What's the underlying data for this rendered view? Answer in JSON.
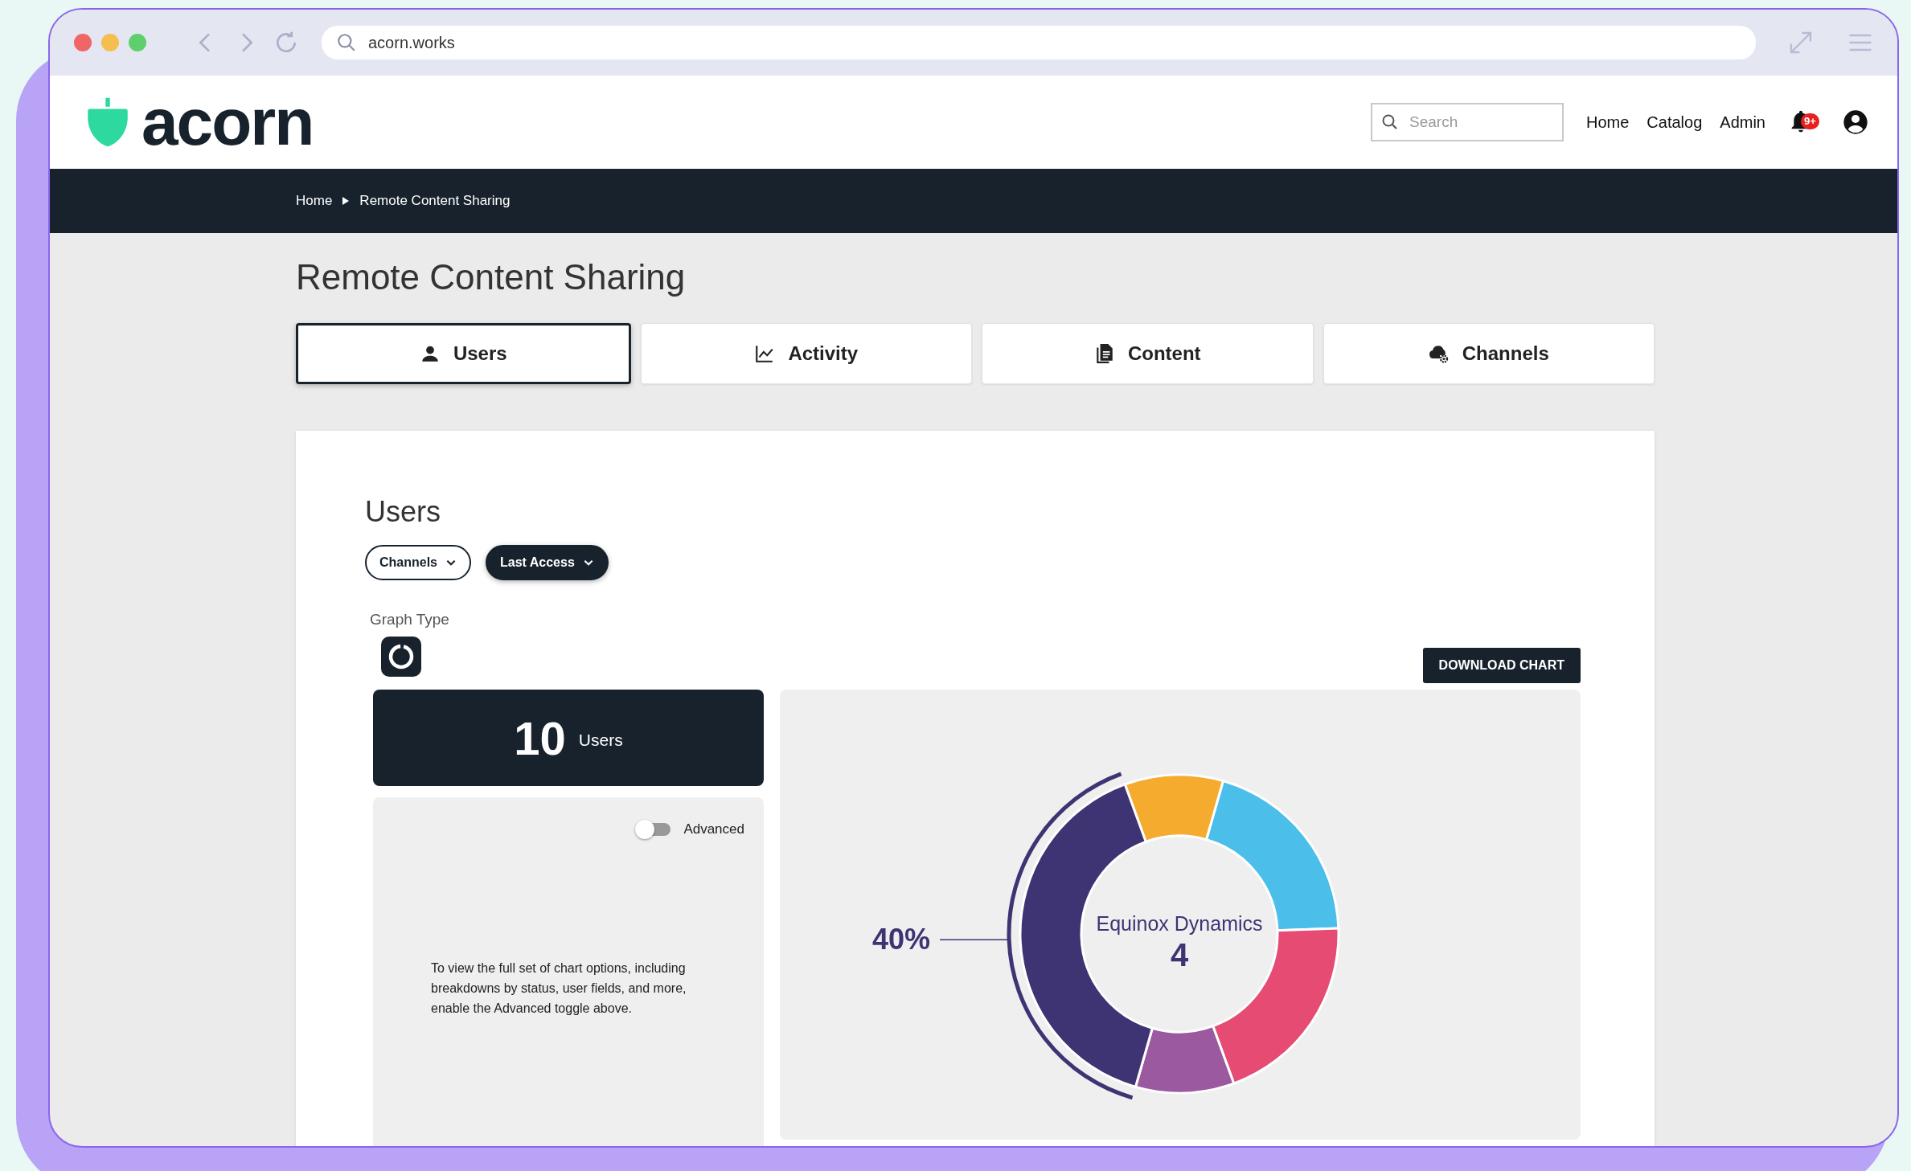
{
  "browser": {
    "url": "acorn.works"
  },
  "header": {
    "logo": "acorn",
    "search": {
      "placeholder": "Search"
    },
    "nav": [
      "Home",
      "Catalog",
      "Admin"
    ],
    "notifications": {
      "badge": "9+"
    }
  },
  "breadcrumb": [
    "Home",
    "Remote Content Sharing"
  ],
  "page_title": "Remote Content Sharing",
  "tabs": [
    {
      "label": "Users",
      "kind": "user",
      "selected": true
    },
    {
      "label": "Activity",
      "kind": "activity",
      "selected": false
    },
    {
      "label": "Content",
      "kind": "content",
      "selected": false
    },
    {
      "label": "Channels",
      "kind": "channels",
      "selected": false
    }
  ],
  "panel": {
    "title": "Users",
    "filters": [
      {
        "label": "Channels",
        "selected": false
      },
      {
        "label": "Last Access",
        "selected": true
      }
    ],
    "graph_type_label": "Graph Type",
    "download_button": "DOWNLOAD CHART",
    "stat": {
      "value": "10",
      "label": "Users"
    },
    "advanced": {
      "label": "Advanced",
      "on": false
    },
    "hint": "To view the full set of chart options, including breakdowns by status, user fields, and more, enable the Advanced toggle above.",
    "chart_callout": {
      "percent": "40%",
      "label": "Equinox Dynamics",
      "value": "4"
    },
    "chart_data": {
      "type": "donut",
      "series": [
        {
          "values": [
            10,
            20,
            20,
            10,
            40
          ]
        }
      ],
      "colors": [
        "#f4ab2e",
        "#4bbfe9",
        "#e54b73",
        "#9b59a0",
        "#3f3473"
      ]
    }
  }
}
